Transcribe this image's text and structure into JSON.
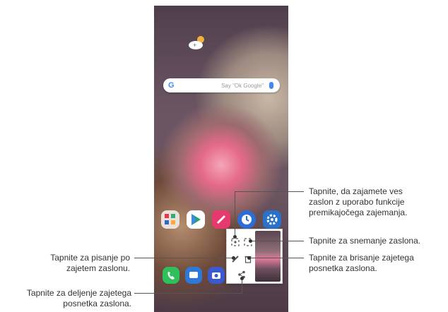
{
  "search": {
    "logo": "G",
    "placeholder": "Say \"Ok Google\""
  },
  "callouts": {
    "scroll_capture": [
      "Tapnite, da zajamete ves",
      "zaslon z uporabo funkcije",
      "premikajočega zajemanja."
    ],
    "capture": "Tapnite za snemanje zaslona.",
    "delete": [
      "Tapnite za brisanje zajetega",
      "posnetka zaslona."
    ],
    "write": [
      "Tapnite za pisanje po",
      "zajetem zaslonu."
    ],
    "share": [
      "Tapnite za deljenje zajetega",
      "posnetka zaslona."
    ]
  },
  "icons": [
    "weather-icon",
    "google-icon",
    "mic-icon",
    "folder-icon",
    "play-store-icon",
    "pen-icon",
    "clock-icon",
    "settings-icon",
    "phone-icon",
    "messages-icon",
    "camera-icon",
    "extended-capture-icon",
    "capture-icon",
    "edit-icon",
    "trash-icon",
    "share-icon"
  ]
}
